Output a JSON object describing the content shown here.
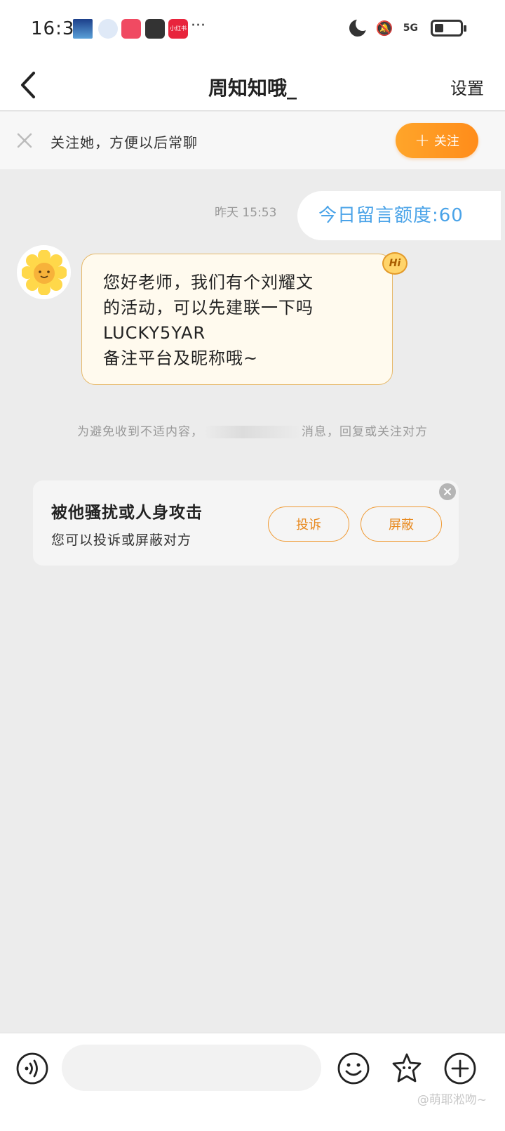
{
  "status_bar": {
    "time": "16:33",
    "icons": [
      "gallery-icon",
      "ai-assistant-icon",
      "video-app-icon",
      "upload-icon",
      "xiaohongshu-icon",
      "more-icon"
    ],
    "dots": "···",
    "network": "5G",
    "xiaohongshu_label": "小红书"
  },
  "header": {
    "title": "周知知哦_",
    "settings_label": "设置"
  },
  "follow_banner": {
    "text": "关注她，方便以后常聊",
    "button_label": "关注",
    "accent_color": "#ff9a22"
  },
  "chat": {
    "timestamp": "昨天 15:53",
    "quota_text": "今日留言额度:60",
    "message_lines": [
      "您好老师，我们有个刘耀文",
      "的活动，可以先建联一下吗",
      "LUCKY5YAR",
      "备注平台及昵称哦~"
    ],
    "hi_badge": "Hi",
    "notice_left": "为避免收到不适内容，",
    "notice_right": "消息，回复或关注对方"
  },
  "harass_card": {
    "title": "被他骚扰或人身攻击",
    "subtitle": "您可以投诉或屏蔽对方",
    "report_label": "投诉",
    "block_label": "屏蔽"
  },
  "bottom_bar": {
    "input_value": "",
    "input_placeholder": "",
    "watermark": "@萌耶淞吻~"
  }
}
